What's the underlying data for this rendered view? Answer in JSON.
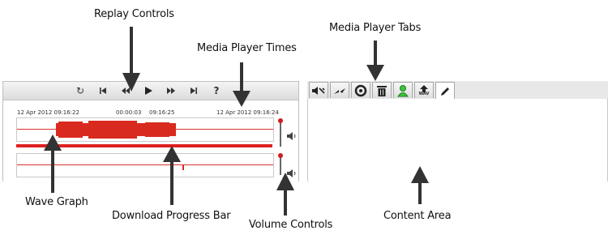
{
  "callouts": {
    "replay_controls": "Replay Controls",
    "media_player_tabs": "Media Player Tabs",
    "media_player_times": "Media Player Times",
    "wave_graph": "Wave Graph",
    "download_progress_bar": "Download Progress Bar",
    "volume_controls": "Volume Controls",
    "content_area": "Content Area"
  },
  "player": {
    "controls": [
      {
        "icon": "loop-icon",
        "glyph": "↻"
      },
      {
        "icon": "skip-start-icon",
        "glyph": "⏮"
      },
      {
        "icon": "rewind-icon",
        "glyph": "⏪"
      },
      {
        "icon": "play-icon",
        "glyph": "▶"
      },
      {
        "icon": "fast-forward-icon",
        "glyph": "⏩"
      },
      {
        "icon": "skip-end-icon",
        "glyph": "⏭"
      },
      {
        "icon": "help-icon",
        "glyph": "?"
      }
    ],
    "times": {
      "start": "12 Apr 2012 09:16:22",
      "elapsed": "00:00:03",
      "current": "09:16:25",
      "end": "12 Apr 2012 09:16:24"
    },
    "download_progress": 1.0
  },
  "tabs": [
    {
      "icon": "speaker-tool-icon"
    },
    {
      "icon": "arrow-forward-icon"
    },
    {
      "icon": "target-icon"
    },
    {
      "icon": "trash-icon"
    },
    {
      "icon": "person-icon"
    },
    {
      "icon": "upload-wav-icon",
      "label": "WAV"
    },
    {
      "icon": "pencil-icon"
    }
  ],
  "colors": {
    "wave": "#d92a1f",
    "accent_red": "#e02020",
    "callout_arrow": "#333333"
  }
}
